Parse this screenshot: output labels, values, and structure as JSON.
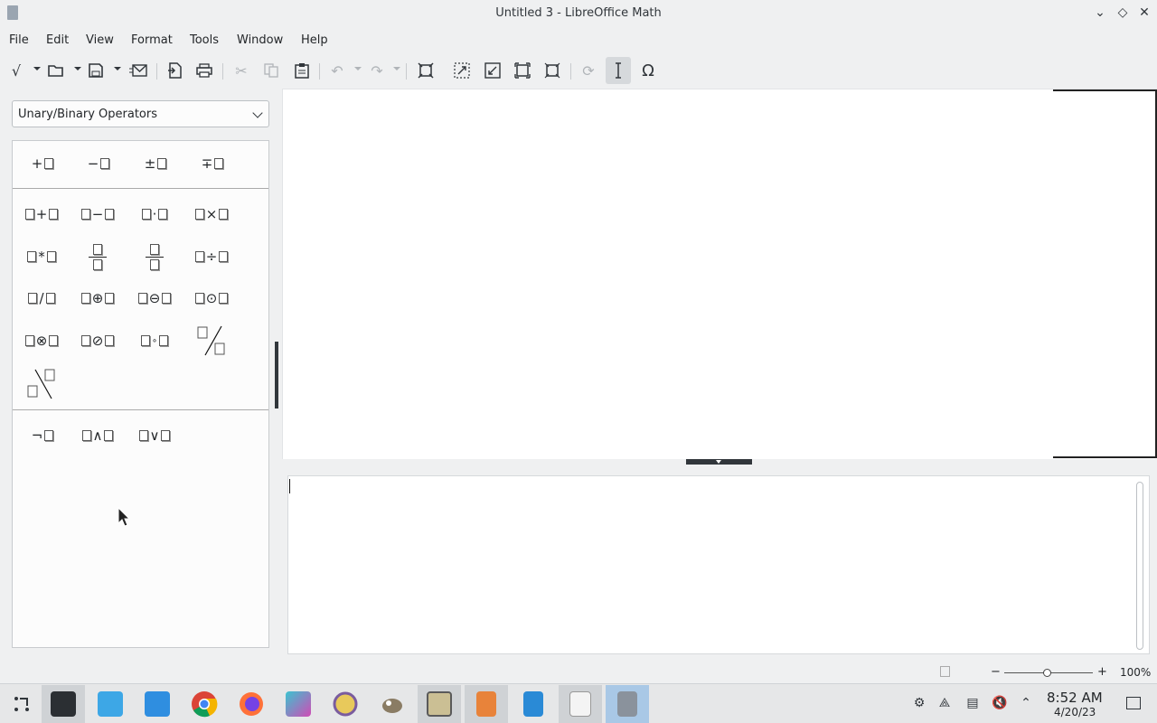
{
  "window": {
    "title": "Untitled 3 - LibreOffice Math"
  },
  "menu": [
    "File",
    "Edit",
    "View",
    "Format",
    "Tools",
    "Window",
    "Help"
  ],
  "toolbar": {
    "icons": [
      "formula-new-icon",
      "open-icon",
      "save-icon",
      "email-icon",
      "export-pdf-icon",
      "print-icon",
      "cut-icon",
      "copy-icon",
      "paste-icon",
      "undo-icon",
      "redo-icon",
      "zoom-100-icon",
      "zoom-in-icon",
      "zoom-out-icon",
      "show-all-icon",
      "formula-cursor-icon",
      "update-icon",
      "formula-cursor-toggle-icon",
      "symbols-icon"
    ],
    "symbols_glyph": "Ω"
  },
  "elements": {
    "category": "Unary/Binary Operators",
    "unary": [
      "+",
      "−",
      "±",
      "∓"
    ],
    "binary": [
      "+",
      "−",
      "·",
      "×",
      "*",
      "÷",
      "/",
      "⊕",
      "⊖",
      "⊙",
      "⊗",
      "⊘",
      "∘"
    ],
    "logic": [
      "¬",
      "∧",
      "∨"
    ]
  },
  "status": {
    "zoom_minus": "−",
    "zoom_plus": "+",
    "zoom_value": "100%"
  },
  "taskbar": {
    "apps": [
      "app-launcher",
      "system-settings",
      "discover",
      "file-manager",
      "chrome",
      "firefox",
      "krita",
      "pidgin",
      "gimp",
      "image-viewer",
      "impress",
      "writer",
      "pdf-reader",
      "math"
    ],
    "clock_time": "8:52 AM",
    "clock_date": "4/20/23"
  }
}
